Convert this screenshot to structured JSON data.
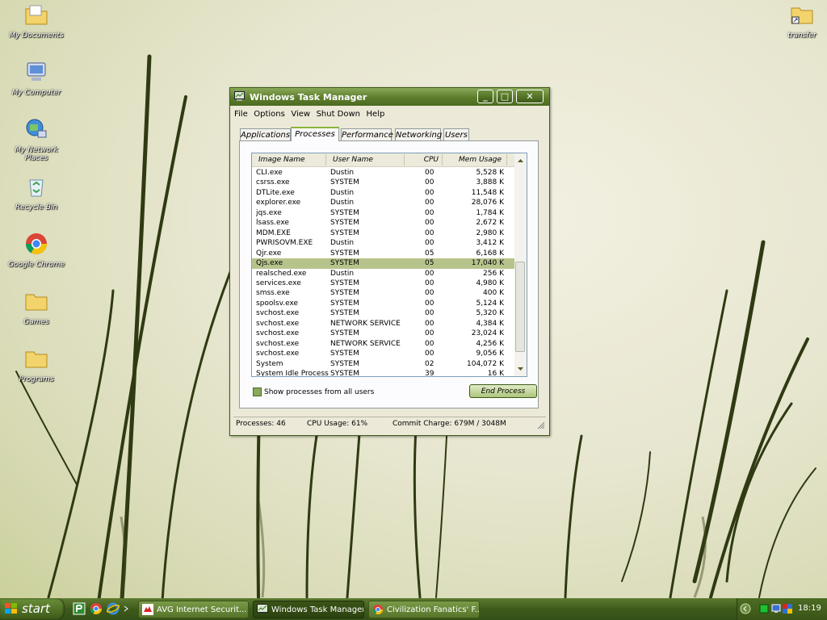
{
  "desktop": {
    "icons": [
      {
        "label": "My Documents",
        "icon": "folder-documents-icon"
      },
      {
        "label": "My Computer",
        "icon": "computer-icon"
      },
      {
        "label": "My Network Places",
        "icon": "network-icon"
      },
      {
        "label": "Recycle Bin",
        "icon": "recycle-bin-icon"
      },
      {
        "label": "Google Chrome",
        "icon": "chrome-icon"
      },
      {
        "label": "Games",
        "icon": "folder-icon"
      },
      {
        "label": "Programs",
        "icon": "folder-icon"
      },
      {
        "label": "transfer",
        "icon": "folder-shortcut-icon"
      }
    ]
  },
  "window": {
    "title": "Windows Task Manager",
    "menu": [
      "File",
      "Options",
      "View",
      "Shut Down",
      "Help"
    ],
    "tabs": [
      "Applications",
      "Processes",
      "Performance",
      "Networking",
      "Users"
    ],
    "active_tab": "Processes",
    "columns": [
      "Image Name",
      "User Name",
      "CPU",
      "Mem Usage"
    ],
    "processes": [
      {
        "image": "CLI.exe",
        "user": "Dustin",
        "cpu": "00",
        "mem": "5,528 K"
      },
      {
        "image": "csrss.exe",
        "user": "SYSTEM",
        "cpu": "00",
        "mem": "3,888 K"
      },
      {
        "image": "DTLite.exe",
        "user": "Dustin",
        "cpu": "00",
        "mem": "11,548 K"
      },
      {
        "image": "explorer.exe",
        "user": "Dustin",
        "cpu": "00",
        "mem": "28,076 K"
      },
      {
        "image": "jqs.exe",
        "user": "SYSTEM",
        "cpu": "00",
        "mem": "1,784 K"
      },
      {
        "image": "lsass.exe",
        "user": "SYSTEM",
        "cpu": "00",
        "mem": "2,672 K"
      },
      {
        "image": "MDM.EXE",
        "user": "SYSTEM",
        "cpu": "00",
        "mem": "2,980 K"
      },
      {
        "image": "PWRISOVM.EXE",
        "user": "Dustin",
        "cpu": "00",
        "mem": "3,412 K"
      },
      {
        "image": "Qjr.exe",
        "user": "SYSTEM",
        "cpu": "05",
        "mem": "6,168 K"
      },
      {
        "image": "Qjs.exe",
        "user": "SYSTEM",
        "cpu": "05",
        "mem": "17,040 K",
        "selected": true
      },
      {
        "image": "realsched.exe",
        "user": "Dustin",
        "cpu": "00",
        "mem": "256 K"
      },
      {
        "image": "services.exe",
        "user": "SYSTEM",
        "cpu": "00",
        "mem": "4,980 K"
      },
      {
        "image": "smss.exe",
        "user": "SYSTEM",
        "cpu": "00",
        "mem": "400 K"
      },
      {
        "image": "spoolsv.exe",
        "user": "SYSTEM",
        "cpu": "00",
        "mem": "5,124 K"
      },
      {
        "image": "svchost.exe",
        "user": "SYSTEM",
        "cpu": "00",
        "mem": "5,320 K"
      },
      {
        "image": "svchost.exe",
        "user": "NETWORK SERVICE",
        "cpu": "00",
        "mem": "4,384 K"
      },
      {
        "image": "svchost.exe",
        "user": "SYSTEM",
        "cpu": "00",
        "mem": "23,024 K"
      },
      {
        "image": "svchost.exe",
        "user": "NETWORK SERVICE",
        "cpu": "00",
        "mem": "4,256 K"
      },
      {
        "image": "svchost.exe",
        "user": "SYSTEM",
        "cpu": "00",
        "mem": "9,056 K"
      },
      {
        "image": "System",
        "user": "SYSTEM",
        "cpu": "02",
        "mem": "104,072 K"
      },
      {
        "image": "System Idle Process",
        "user": "SYSTEM",
        "cpu": "39",
        "mem": "16 K"
      }
    ],
    "show_all_label": "Show processes from all users",
    "end_process_label": "End Process",
    "status": {
      "processes": "Processes: 46",
      "cpu": "CPU Usage: 61%",
      "commit": "Commit Charge: 679M / 3048M"
    }
  },
  "taskbar": {
    "start_label": "start",
    "tasks": [
      {
        "label": "AVG Internet Securit...",
        "active": false
      },
      {
        "label": "Windows Task Manager",
        "active": true
      },
      {
        "label": "Civilization Fanatics' F...",
        "active": false
      }
    ],
    "clock": "18:19"
  },
  "colors": {
    "accent": "#5d7d2c",
    "selection": "#b6c48c",
    "window_bg": "#ece9d8"
  }
}
